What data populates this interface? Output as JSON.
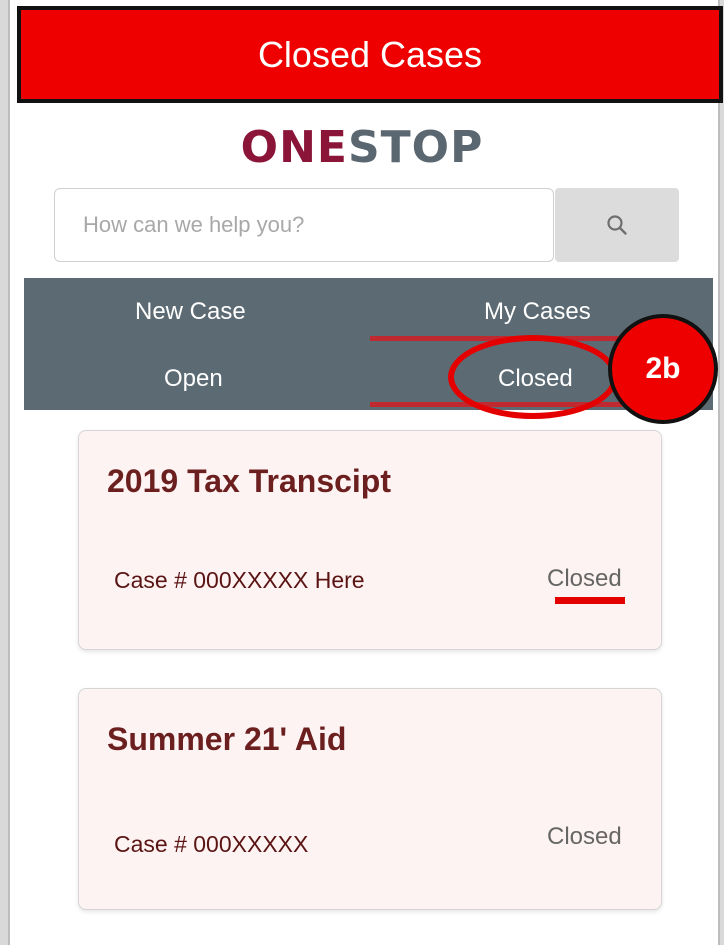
{
  "title_banner": {
    "text": "Closed Cases"
  },
  "logo": {
    "part1": "ONE",
    "part2": "STOP"
  },
  "search": {
    "placeholder": "How can we help you?",
    "icon": "search-icon"
  },
  "nav": {
    "new_case": "New Case",
    "my_cases": "My Cases",
    "open": "Open",
    "closed": "Closed"
  },
  "annotation": {
    "label": "2b"
  },
  "cases": [
    {
      "title": "2019 Tax Transcipt",
      "case_number": "Case # 000XXXXX Here",
      "status": "Closed"
    },
    {
      "title": "Summer 21' Aid",
      "case_number": "Case # 000XXXXX",
      "status": "Closed"
    }
  ],
  "colors": {
    "banner": "#ee0000",
    "brand_maroon": "#8a1538",
    "brand_gray": "#5b6770",
    "nav_bg": "#5c6b73",
    "card_bg": "#fdf3f2",
    "accent_red": "#c0292f"
  }
}
